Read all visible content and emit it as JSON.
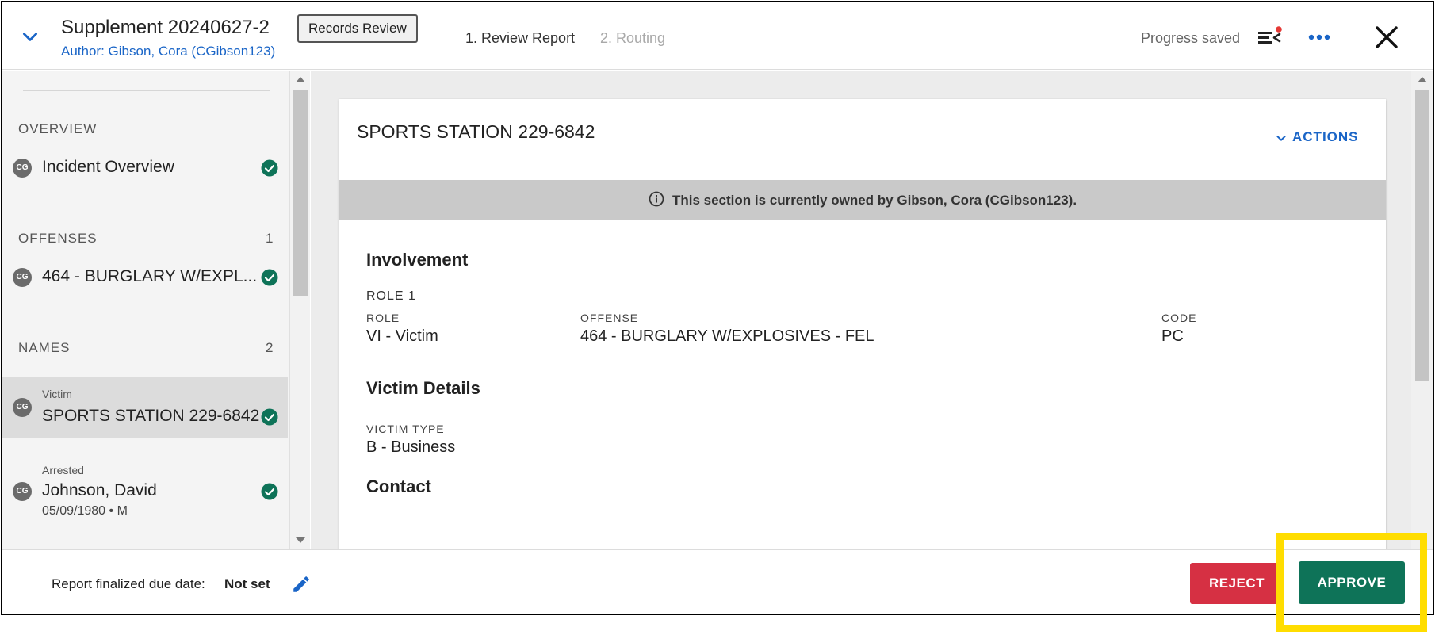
{
  "header": {
    "title": "Supplement 20240627-2",
    "author": "Author: Gibson, Cora (CGibson123)",
    "badge": "Records Review",
    "steps": [
      "1. Review Report",
      "2. Routing"
    ],
    "status": "Progress saved",
    "icons": [
      "chevron-down-icon",
      "queue-list-icon",
      "more-horizontal-icon",
      "close-icon"
    ],
    "notification_dot_color": "#e53935"
  },
  "sidebar": {
    "sections": [
      {
        "label": "OVERVIEW"
      },
      {
        "label": "OFFENSES",
        "count": "1"
      },
      {
        "label": "NAMES",
        "count": "2"
      }
    ],
    "items": [
      {
        "avatar": "CG",
        "label": "Incident Overview",
        "complete": true
      },
      {
        "avatar": "CG",
        "label": "464 - BURGLARY W/EXPL...",
        "complete": true
      },
      {
        "avatar": "CG",
        "sublabel": "Victim",
        "label": "SPORTS STATION 229-6842",
        "complete": true,
        "selected": true
      },
      {
        "avatar": "CG",
        "sublabel": "Arrested",
        "label": "Johnson, David",
        "meta": "05/09/1980 • M",
        "complete": true
      }
    ]
  },
  "card": {
    "title": "SPORTS STATION 229-6842",
    "actions_label": "ACTIONS",
    "owner_banner": "This section is currently owned by Gibson, Cora (CGibson123).",
    "involvement": {
      "title": "Involvement",
      "role_heading": "ROLE 1",
      "fields": [
        {
          "label": "ROLE",
          "value": "VI - Victim"
        },
        {
          "label": "OFFENSE",
          "value": "464 - BURGLARY W/EXPLOSIVES - FEL"
        },
        {
          "label": "CODE",
          "value": "PC"
        }
      ]
    },
    "victim_details": {
      "title": "Victim Details",
      "fields": [
        {
          "label": "VICTIM TYPE",
          "value": "B - Business"
        }
      ]
    },
    "contact": {
      "title": "Contact"
    }
  },
  "footer": {
    "due_label": "Report finalized due date:",
    "due_value": "Not set",
    "reject_label": "REJECT",
    "approve_label": "APPROVE",
    "colors": {
      "reject": "#d63043",
      "approve": "#0e7358",
      "highlight": "#ffdd00",
      "complete_check": "#0e7358",
      "link": "#1a65c7"
    }
  }
}
